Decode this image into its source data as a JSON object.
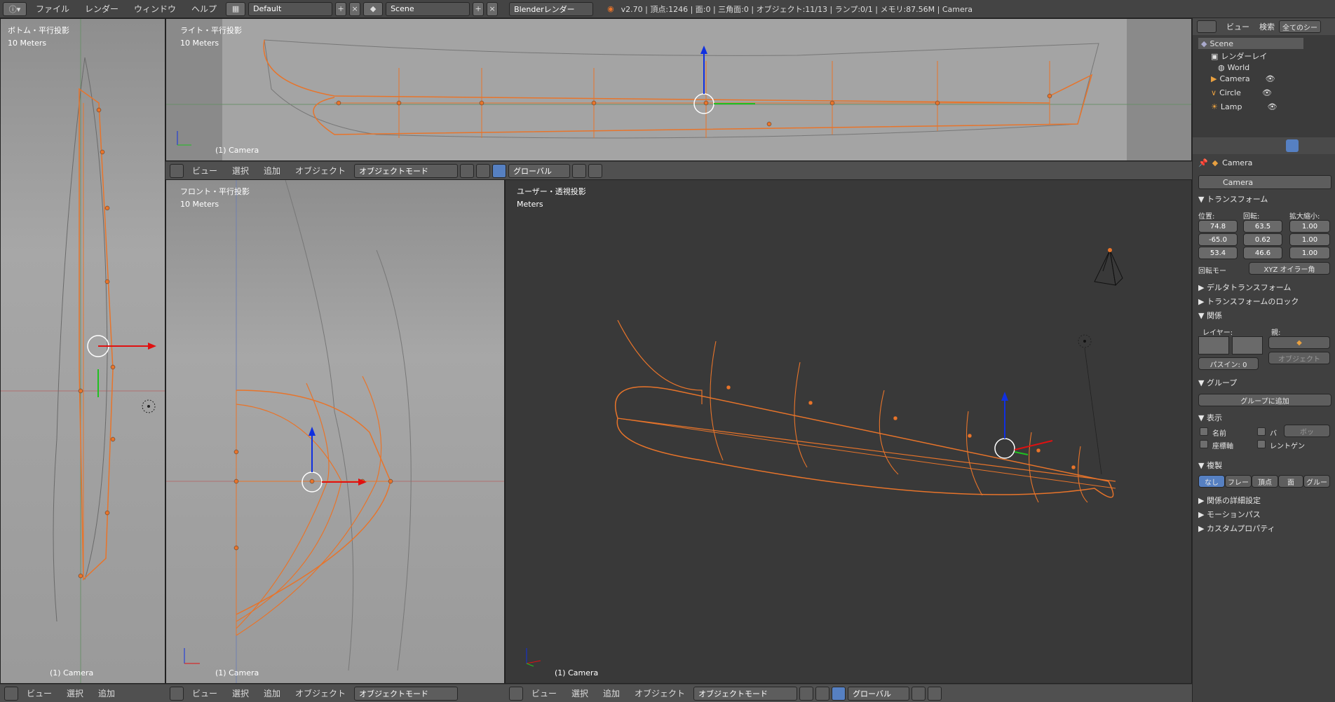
{
  "topbar": {
    "menus": [
      "ファイル",
      "レンダー",
      "ウィンドウ",
      "ヘルプ"
    ],
    "layout": "Default",
    "scene": "Scene",
    "engine": "Blenderレンダー",
    "stats": "v2.70 | 頂点:1246 | 面:0 | 三角面:0 | オブジェクト:11/13 | ランプ:0/1 | メモリ:87.56M | Camera"
  },
  "viewports": {
    "bottom": {
      "label": "ボトム・平行投影",
      "scale": "10 Meters",
      "camera": "(1) Camera"
    },
    "right": {
      "label": "ライト・平行投影",
      "scale": "10 Meters",
      "camera": "(1) Camera"
    },
    "front": {
      "label": "フロント・平行投影",
      "scale": "10 Meters",
      "camera": "(1) Camera"
    },
    "user": {
      "label": "ユーザー・透視投影",
      "scale": "Meters",
      "camera": "(1) Camera"
    }
  },
  "header": {
    "menus": [
      "ビュー",
      "選択",
      "追加",
      "オブジェクト"
    ],
    "mode": "オブジェクトモード",
    "orientation": "グローバル"
  },
  "outliner": {
    "menus": [
      "ビュー",
      "検索"
    ],
    "filter": "全てのシー",
    "items": [
      "Scene",
      "レンダーレイ",
      "World",
      "Camera",
      "Circle",
      "Lamp"
    ]
  },
  "properties": {
    "object_name": "Camera",
    "breadcrumb": "Camera",
    "transform": {
      "title": "トランスフォーム",
      "loc_label": "位置:",
      "rot_label": "回転:",
      "scale_label": "拡大縮小:",
      "loc": [
        "74.8",
        "-65.0",
        "53.4"
      ],
      "rot": [
        "63.5",
        "0.62",
        "46.6"
      ],
      "scale": [
        "1.00",
        "1.00",
        "1.00"
      ],
      "rot_mode_label": "回転モー",
      "rot_mode": "XYZ オイラー角"
    },
    "delta": "デルタトランスフォーム",
    "lock": "トランスフォームのロック",
    "relations": {
      "title": "関係",
      "layer_label": "レイヤー:",
      "parent_label": "親:",
      "parent_type": "オブジェクト",
      "pass": "パスイン: 0"
    },
    "groups": {
      "title": "グループ",
      "add": "グループに追加"
    },
    "display": {
      "title": "表示",
      "name": "名前",
      "axis": "座標軸",
      "bounds": "バ",
      "bounds_type": "ボッ",
      "xray": "レントゲン"
    },
    "duplication": {
      "title": "複製",
      "options": [
        "なし",
        "フレー",
        "頂点",
        "面",
        "グルー"
      ]
    },
    "rel_extras": "関係の詳細設定",
    "motion_path": "モーションパス",
    "custom_props": "カスタムプロパティ"
  },
  "colors": {
    "accent": "#5680c2",
    "curve": "#e8742a",
    "bg": "#393939"
  }
}
